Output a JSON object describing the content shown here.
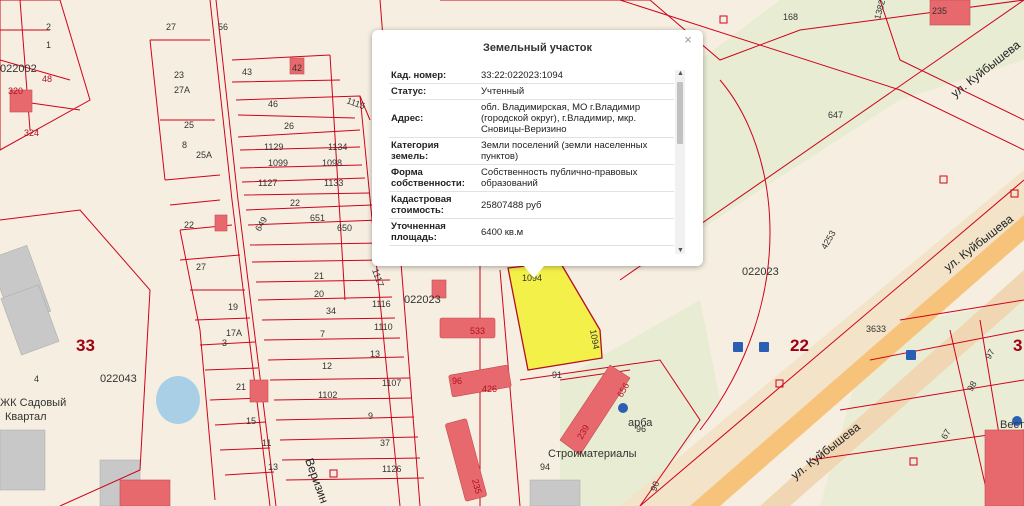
{
  "popup": {
    "title": "Земельный участок",
    "close": "×",
    "rows": [
      {
        "key": "Кад. номер:",
        "value": "33:22:022023:1094"
      },
      {
        "key": "Статус:",
        "value": "Учтенный"
      },
      {
        "key": "Адрес:",
        "value": "обл. Владимирская, МО г.Владимир (городской округ), г.Владимир, мкр. Сновицы-Веризино"
      },
      {
        "key": "Категория земель:",
        "value": "Земли поселений (земли населенных пунктов)"
      },
      {
        "key": "Форма собственности:",
        "value": "Собственность публично-правовых образований"
      },
      {
        "key": "Кадастровая стоимость:",
        "value": "25807488 руб"
      },
      {
        "key": "Уточненная площадь:",
        "value": "6400 кв.м"
      }
    ],
    "scroll_up": "▲",
    "scroll_down": "▼"
  },
  "map": {
    "colors": {
      "parcel_border": "#d0021b",
      "background": "#f6efe1",
      "highlight": "#f4f04a",
      "road": "#f7c27a",
      "building": "#e8696d"
    },
    "labels": {
      "q_33": "33",
      "q_22": "22",
      "q_3_edge": "3",
      "district_022043": "022043",
      "district_022023_a": "022023",
      "district_022023_b": "022023",
      "district_022002": "022002",
      "street_kuibysheva_1": "ул. Куйбышева",
      "street_kuibysheva_2": "ул. Куйбышева",
      "street_kuibysheva_3": "ул. Куйбышева",
      "street_verizino": "Веризин",
      "zk_1": "ЖК Садовый",
      "zk_2": "Квартал",
      "poi_1": "Строиматериалы",
      "poi_2": "арба",
      "poi_3": "Вест",
      "sel_parcel": "1094",
      "sel_parcel_tag": "1094",
      "p_168": "168",
      "p_647": "647",
      "p_4253": "4253",
      "p_3633": "3633",
      "p_96a": "96",
      "p_91": "91",
      "p_90": "90",
      "p_94": "94",
      "p_96b": "96",
      "p_426": "426",
      "p_533": "533",
      "p_656": "656",
      "p_235": "235",
      "p_239": "239",
      "p_43": "43",
      "p_42": "42",
      "p_46": "46",
      "p_1115": "1115",
      "p_26": "26",
      "p_1129": "1129",
      "p_1134": "1134",
      "p_1099": "1099",
      "p_1098": "1098",
      "p_1127": "1127",
      "p_1133": "1133",
      "p_22": "22",
      "p_651": "651",
      "p_650": "650",
      "p_649": "649",
      "p_1117": "1117",
      "p_21": "21",
      "p_20": "20",
      "p_34": "34",
      "p_1116": "1116",
      "p_7": "7",
      "p_1110": "1110",
      "p_13": "13",
      "p_12": "12",
      "p_1107": "1107",
      "p_1102": "1102",
      "p_9": "9",
      "p_37": "37",
      "p_1126": "1126",
      "p_23": "23",
      "p_27a": "27А",
      "p_25": "25",
      "p_8": "8",
      "p_25a": "25А",
      "p_27": "27",
      "p_19": "19",
      "p_17a": "17А",
      "p_3": "3",
      "p_21b": "21",
      "p_15": "15",
      "p_11": "11",
      "p_13b": "13",
      "p_320": "320",
      "p_48": "48",
      "p_324": "324",
      "p_4": "4",
      "p_27b": "27",
      "p_56": "56",
      "p_97": "97",
      "p_98": "98",
      "p_67": "67",
      "p_2": "2",
      "p_1": "1",
      "p_22b": "22",
      "p_1382": "1382",
      "p_235b": "235"
    }
  }
}
